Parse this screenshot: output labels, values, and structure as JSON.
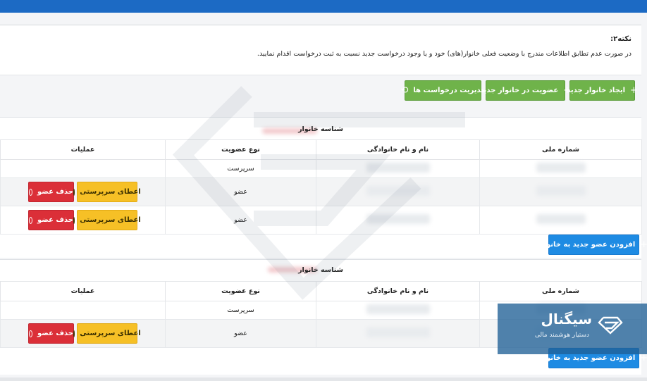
{
  "note": {
    "title": "نکته۲:",
    "text": "در صورت عدم تطابق اطلاعات مندرج با وضعیت فعلی خانوار(های) خود و یا وجود درخواست جدید نسبت به ثبت درخواست اقدام نمایید."
  },
  "toolbar": {
    "create_household": "ایجاد خانوار جدید",
    "join_household": "عضویت در خانوار جدید",
    "manage_requests": "مدیریت درخواست ها"
  },
  "columns": {
    "national_id": "شماره ملی",
    "full_name": "نام و نام خانوادگی",
    "membership_type": "نوع عضویت",
    "operations": "عملیات"
  },
  "actions": {
    "grant_head": "اعطای سرپرستی",
    "remove_member": "حذف عضو",
    "add_member": "افزودن عضو جدید به خانوار"
  },
  "households": [
    {
      "title": "شناسه خانوار",
      "rows": [
        {
          "membership": "سرپرست",
          "has_actions": false
        },
        {
          "membership": "عضو",
          "has_actions": true
        },
        {
          "membership": "عضو",
          "has_actions": true
        }
      ]
    },
    {
      "title": "شناسه خانوار",
      "rows": [
        {
          "membership": "سرپرست",
          "has_actions": false
        },
        {
          "membership": "عضو",
          "has_actions": true
        }
      ]
    }
  ],
  "brand": {
    "name": "سیگنال",
    "tagline": "دستیار هوشمند مالی"
  },
  "colors": {
    "topbar": "#1c6ac4",
    "green": "#6fb34a",
    "blue": "#1e8be3",
    "yellow": "#f6c026",
    "red": "#db2f38"
  }
}
